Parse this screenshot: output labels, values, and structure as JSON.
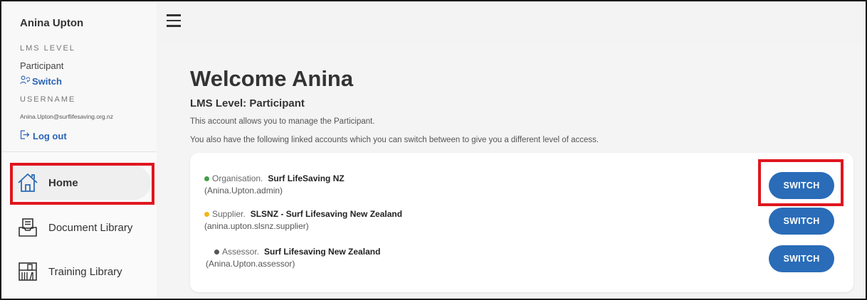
{
  "user": {
    "name": "Anina Upton",
    "lms_level_label": "LMS LEVEL",
    "lms_level_value": "Participant",
    "switch_label": "Switch",
    "username_label": "USERNAME",
    "username_value": "Anina.Upton@surflifesaving.org.nz",
    "logout_label": "Log out"
  },
  "nav": {
    "items": [
      {
        "label": "Home",
        "icon": "house-icon",
        "active": true
      },
      {
        "label": "Document Library",
        "icon": "document-tray-icon",
        "active": false
      },
      {
        "label": "Training Library",
        "icon": "books-icon",
        "active": false
      }
    ]
  },
  "main": {
    "welcome": "Welcome Anina",
    "lms_heading": "LMS Level: Participant",
    "desc1": "This account allows you to manage the Participant.",
    "desc2": "You also have the following linked accounts which you can switch between to give you a different level of access.",
    "accounts": [
      {
        "type": "Organisation.",
        "name": "Surf LifeSaving NZ",
        "handle": "(Anina.Upton.admin)",
        "dot_color": "#43a047",
        "button": "SWITCH"
      },
      {
        "type": "Supplier.",
        "name": "SLSNZ - Surf Lifesaving New Zealand",
        "handle": "(anina.upton.slsnz.supplier)",
        "dot_color": "#f2b51b",
        "button": "SWITCH"
      },
      {
        "type": "Assessor.",
        "name": "Surf Lifesaving New Zealand",
        "handle": "(Anina.Upton.assessor)",
        "dot_color": "#555555",
        "button": "SWITCH"
      }
    ]
  },
  "colors": {
    "accent": "#2a6cb8",
    "highlight": "#e0161e"
  }
}
